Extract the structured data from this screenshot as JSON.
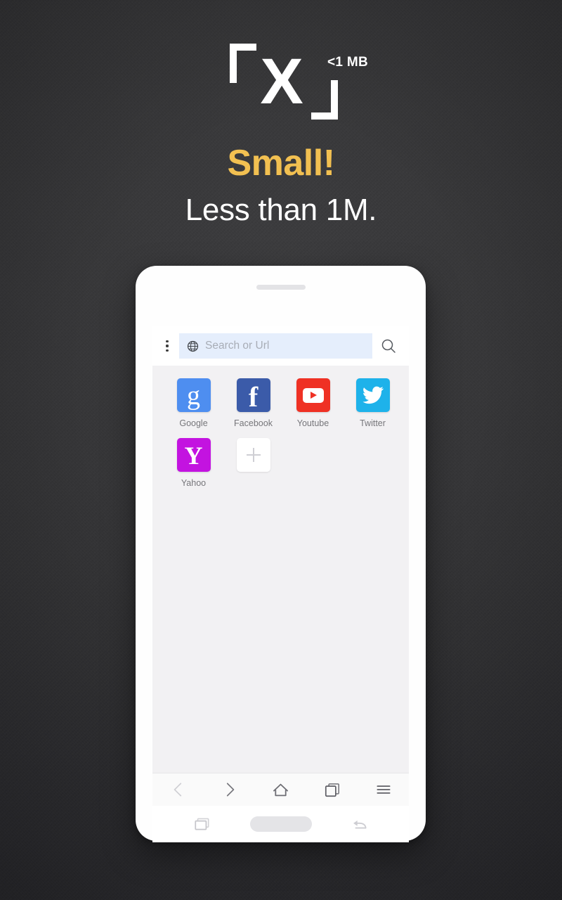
{
  "promo": {
    "logo": {
      "mark": "X",
      "badge": "<1 MB",
      "bracket_open": "「",
      "bracket_close": "」"
    },
    "headline": "Small!",
    "subheadline": "Less than 1M.",
    "colors": {
      "background": "#2e2e30",
      "headline": "#f2c051",
      "subheadline": "#ffffff",
      "logo": "#ffffff"
    }
  },
  "phone": {
    "browser": {
      "menu_icon": "kebab-menu-icon",
      "address_bar": {
        "value": "",
        "placeholder": "Search or Url",
        "leading_icon": "globe-icon"
      },
      "search_icon": "search-icon",
      "shortcuts": [
        {
          "label": "Google",
          "icon": "google-icon",
          "color": "#4e8ef0",
          "glyph": "g"
        },
        {
          "label": "Facebook",
          "icon": "facebook-icon",
          "color": "#3b5ba9",
          "glyph": "f"
        },
        {
          "label": "Youtube",
          "icon": "youtube-icon",
          "color": "#ef3124",
          "glyph": "▶"
        },
        {
          "label": "Twitter",
          "icon": "twitter-icon",
          "color": "#1eb2ea",
          "glyph": "🐦"
        },
        {
          "label": "Yahoo",
          "icon": "yahoo-icon",
          "color": "#c313e0",
          "glyph": "Y"
        },
        {
          "label": "",
          "icon": "add-shortcut-icon",
          "color": "#ffffff",
          "glyph": "+"
        }
      ],
      "toolbar": [
        {
          "name": "back-button",
          "icon": "chevron-left-icon",
          "state": "disabled"
        },
        {
          "name": "forward-button",
          "icon": "chevron-right-icon",
          "state": "enabled"
        },
        {
          "name": "home-button",
          "icon": "home-icon",
          "state": "enabled"
        },
        {
          "name": "tabs-button",
          "icon": "tabs-icon",
          "state": "enabled"
        },
        {
          "name": "menu-button",
          "icon": "hamburger-icon",
          "state": "enabled"
        }
      ]
    },
    "system_nav": [
      {
        "name": "recents-button",
        "icon": "recents-square-icon"
      },
      {
        "name": "home-button",
        "icon": "home-pill-icon"
      },
      {
        "name": "back-button",
        "icon": "back-arrow-icon"
      }
    ]
  }
}
